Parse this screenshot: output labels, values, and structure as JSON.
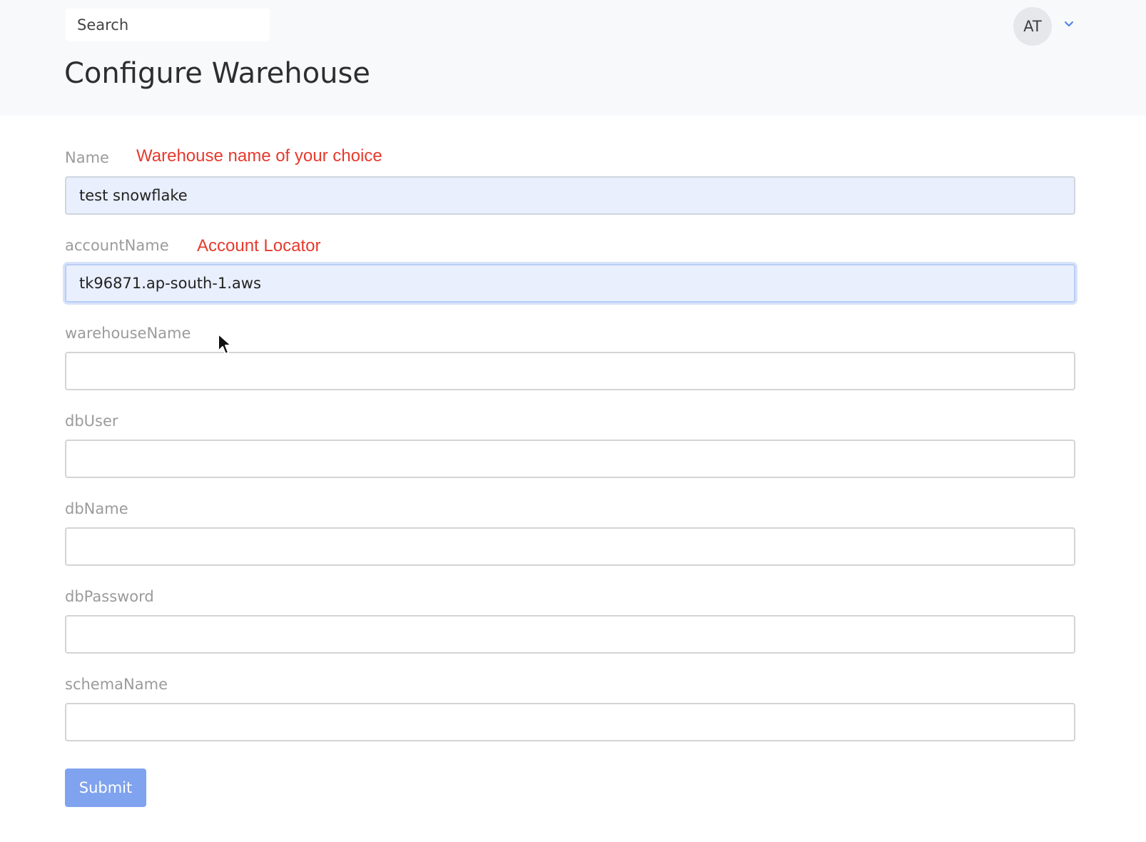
{
  "header": {
    "search_placeholder": "Search",
    "avatar_initials": "AT",
    "avatar_menu_icon": "chevron-down-icon"
  },
  "page": {
    "title": "Configure Warehouse"
  },
  "form": {
    "name": {
      "label": "Name",
      "hint": "Warehouse name of your choice",
      "value": "test snowflake"
    },
    "accountName": {
      "label": "accountName",
      "hint": "Account Locator",
      "value": "tk96871.ap-south-1.aws"
    },
    "warehouseName": {
      "label": "warehouseName",
      "value": ""
    },
    "dbUser": {
      "label": "dbUser",
      "value": ""
    },
    "dbName": {
      "label": "dbName",
      "value": ""
    },
    "dbPassword": {
      "label": "dbPassword",
      "value": ""
    },
    "schemaName": {
      "label": "schemaName",
      "value": ""
    },
    "submit_label": "Submit"
  },
  "colors": {
    "hint": "#e53a2d",
    "submit": "#7fa3ee",
    "filled_field": "#e9effc"
  }
}
